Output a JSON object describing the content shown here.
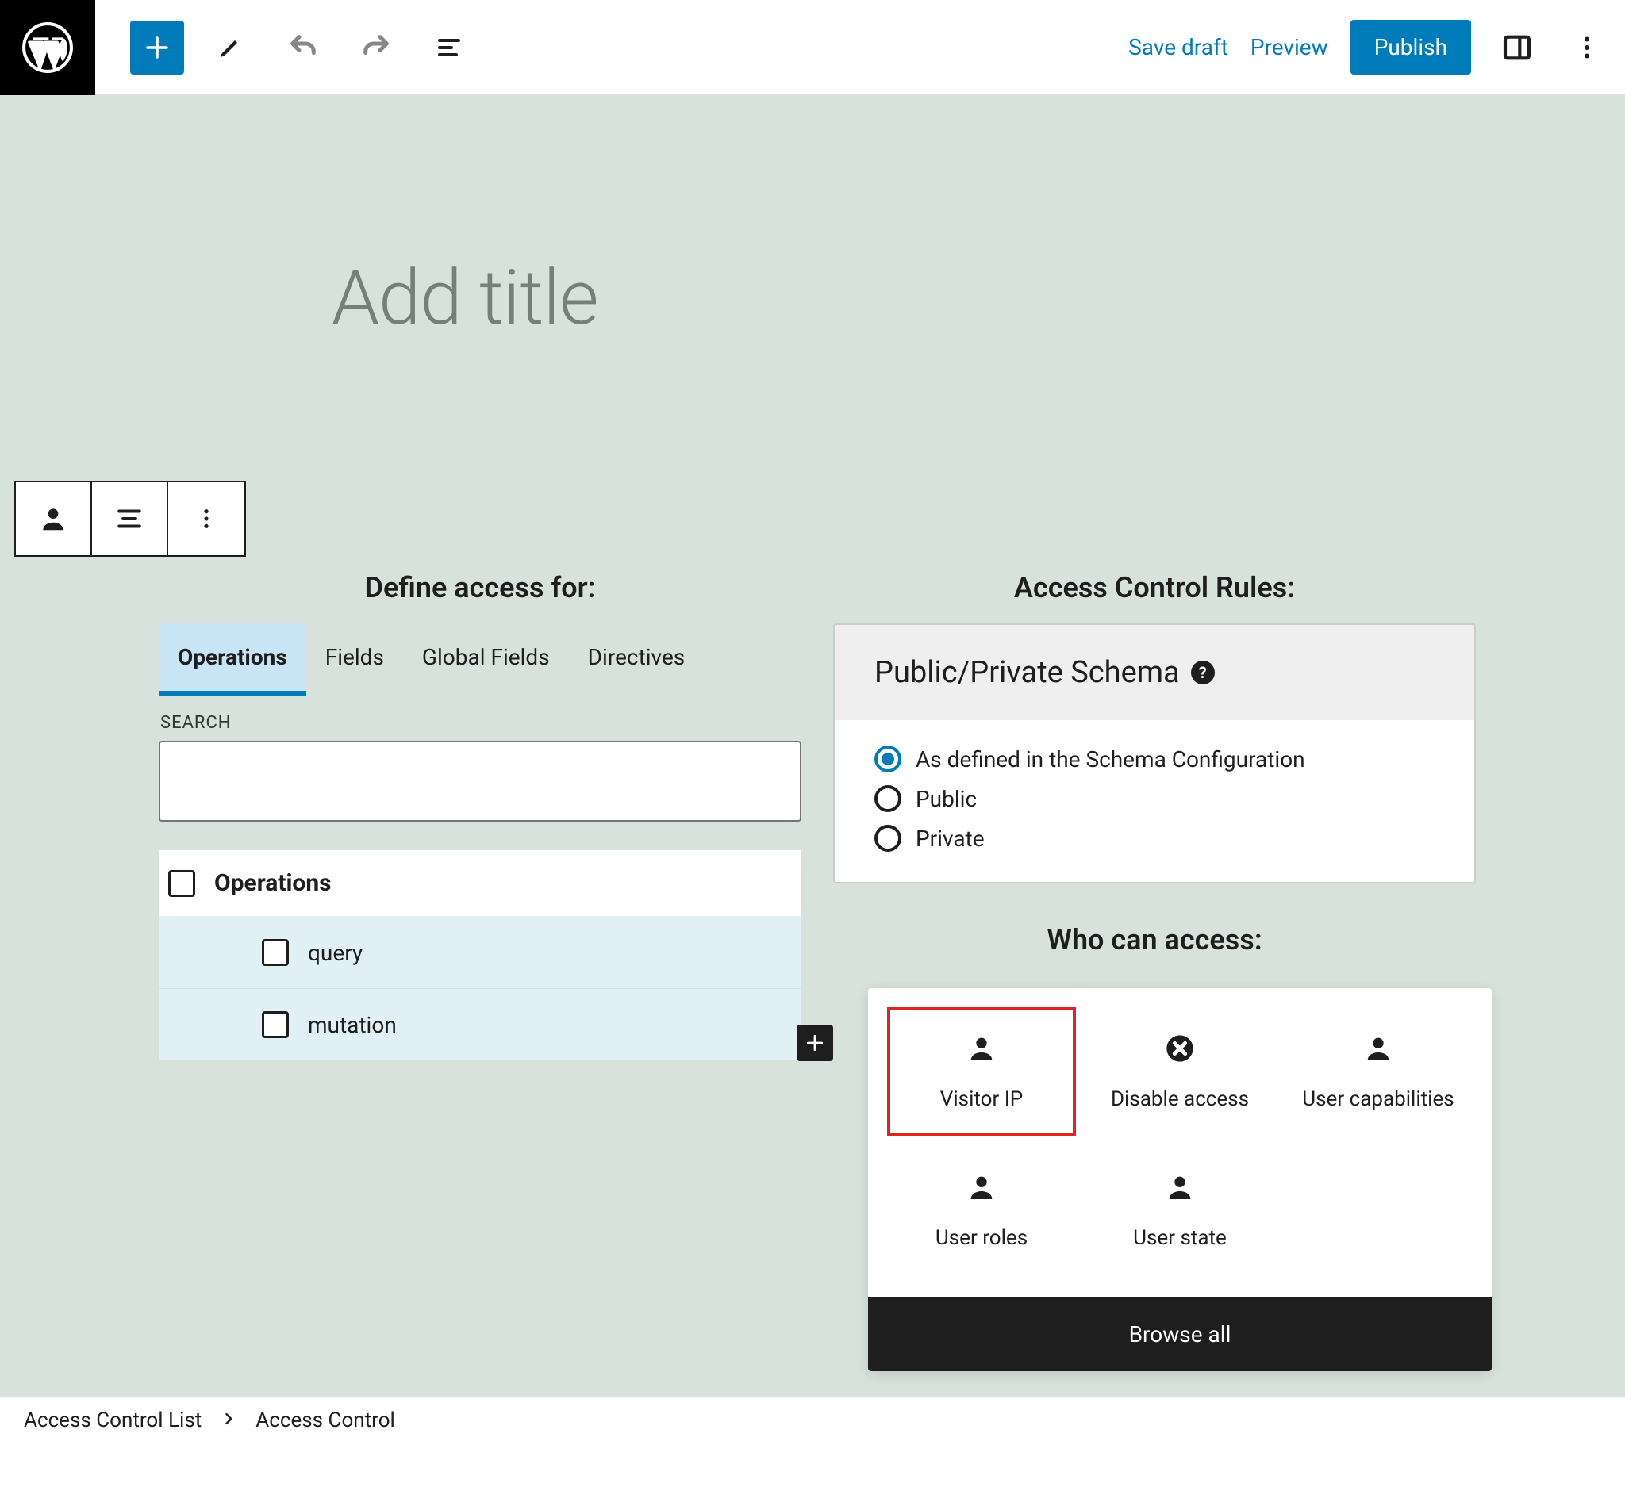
{
  "topbar": {
    "save_draft": "Save draft",
    "preview": "Preview",
    "publish": "Publish"
  },
  "title_placeholder": "Add title",
  "left": {
    "heading": "Define access for:",
    "tabs": [
      "Operations",
      "Fields",
      "Global Fields",
      "Directives"
    ],
    "search_label": "SEARCH",
    "tree_header": "Operations",
    "tree_items": [
      "query",
      "mutation"
    ]
  },
  "right": {
    "rules_heading": "Access Control Rules:",
    "schema_card_title": "Public/Private Schema",
    "schema_options": [
      "As defined in the Schema Configuration",
      "Public",
      "Private"
    ],
    "who_heading": "Who can access:",
    "who_items": [
      {
        "label": "Visitor IP",
        "icon": "person",
        "highlight": true
      },
      {
        "label": "Disable access",
        "icon": "ban",
        "highlight": false
      },
      {
        "label": "User capabilities",
        "icon": "person",
        "highlight": false
      },
      {
        "label": "User roles",
        "icon": "person",
        "highlight": false
      },
      {
        "label": "User state",
        "icon": "person",
        "highlight": false
      }
    ],
    "browse_all": "Browse all"
  },
  "breadcrumb": [
    "Access Control List",
    "Access Control"
  ]
}
